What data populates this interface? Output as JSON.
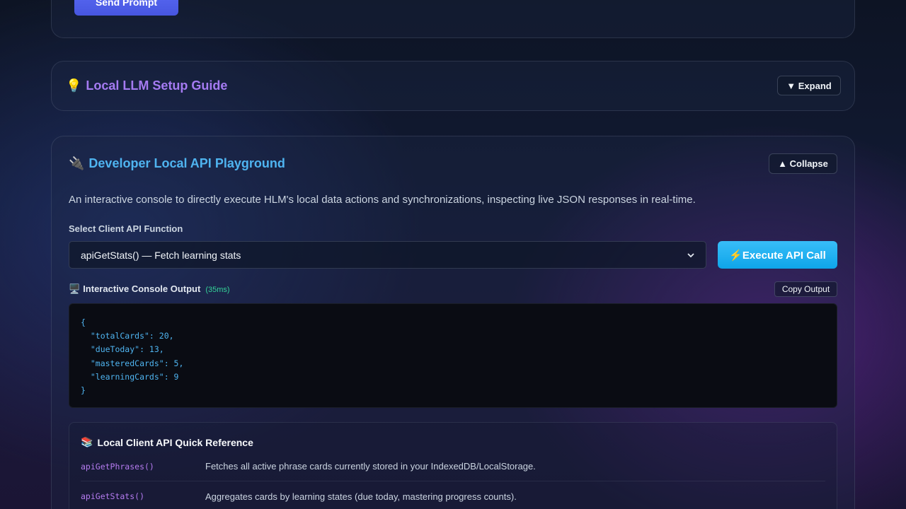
{
  "prompt_card": {
    "send_label": "Send Prompt"
  },
  "setup_guide": {
    "icon": "lightbulb-icon",
    "emoji": "💡",
    "title": "Local LLM Setup Guide",
    "expand_label": "▼ Expand"
  },
  "api_playground": {
    "icon": "plug-icon",
    "emoji": "🔌",
    "title": "Developer Local API Playground",
    "collapse_label": "▲ Collapse",
    "description": "An interactive console to directly execute HLM's local data actions and synchronizations, inspecting live JSON responses in real-time.",
    "select_label": "Select Client API Function",
    "selected_function": "apiGetStats() — Fetch learning stats",
    "execute_label": "⚡Execute API Call",
    "console_label": "Interactive Console Output",
    "console_emoji": "🖥️",
    "latency": "(35ms)",
    "copy_label": "Copy Output",
    "console_output": "{\n  \"totalCards\": 20,\n  \"dueToday\": 13,\n  \"masteredCards\": 5,\n  \"learningCards\": 9\n}"
  },
  "reference": {
    "emoji": "📚",
    "title": "Local Client API Quick Reference",
    "rows": [
      {
        "fn": "apiGetPhrases()",
        "desc": "Fetches all active phrase cards currently stored in your IndexedDB/LocalStorage."
      },
      {
        "fn": "apiGetStats()",
        "desc": "Aggregates cards by learning states (due today, mastering progress counts)."
      }
    ]
  },
  "colors": {
    "accent_purple": "#a57bf2",
    "accent_blue": "#4fb4f0",
    "send_button": "#4f5ff0",
    "latency_green": "#34d399"
  }
}
